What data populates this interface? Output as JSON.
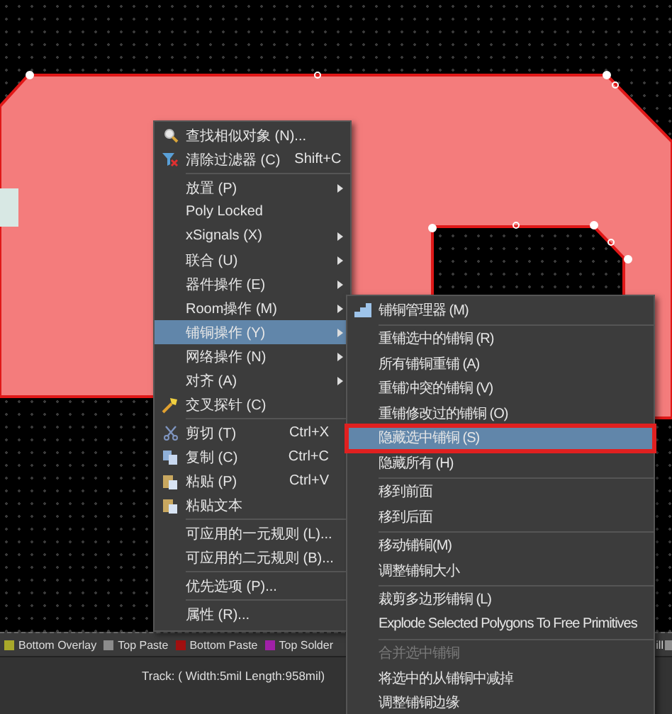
{
  "context_menu": {
    "items": [
      {
        "kind": "item",
        "label": "查找相似对象 (N)...",
        "selected": false,
        "has_submenu": false
      },
      {
        "kind": "item",
        "label": "清除过滤器 (C)",
        "shortcut": "Shift+C",
        "selected": false,
        "has_submenu": false
      },
      {
        "kind": "separator"
      },
      {
        "kind": "item",
        "label": "放置 (P)",
        "selected": false,
        "has_submenu": true
      },
      {
        "kind": "item",
        "label": "Poly Locked",
        "selected": false,
        "has_submenu": false
      },
      {
        "kind": "item",
        "label": "xSignals (X)",
        "selected": false,
        "has_submenu": true
      },
      {
        "kind": "item",
        "label": "联合 (U)",
        "selected": false,
        "has_submenu": true
      },
      {
        "kind": "item",
        "label": "器件操作 (E)",
        "selected": false,
        "has_submenu": true
      },
      {
        "kind": "item",
        "label": "Room操作 (M)",
        "selected": false,
        "has_submenu": true
      },
      {
        "kind": "item",
        "label": "铺铜操作 (Y)",
        "selected": true,
        "has_submenu": true
      },
      {
        "kind": "item",
        "label": "网络操作 (N)",
        "selected": false,
        "has_submenu": true
      },
      {
        "kind": "item",
        "label": "对齐 (A)",
        "selected": false,
        "has_submenu": true
      },
      {
        "kind": "item",
        "label": "交叉探针 (C)",
        "selected": false,
        "has_submenu": false
      },
      {
        "kind": "separator"
      },
      {
        "kind": "item",
        "label": "剪切 (T)",
        "shortcut": "Ctrl+X",
        "selected": false,
        "has_submenu": false
      },
      {
        "kind": "item",
        "label": "复制 (C)",
        "shortcut": "Ctrl+C",
        "selected": false,
        "has_submenu": false
      },
      {
        "kind": "item",
        "label": "粘贴 (P)",
        "shortcut": "Ctrl+V",
        "selected": false,
        "has_submenu": false
      },
      {
        "kind": "item",
        "label": "粘贴文本",
        "selected": false,
        "has_submenu": false
      },
      {
        "kind": "separator"
      },
      {
        "kind": "item",
        "label": "可应用的一元规则 (L)...",
        "selected": false,
        "has_submenu": false
      },
      {
        "kind": "item",
        "label": "可应用的二元规则 (B)...",
        "selected": false,
        "has_submenu": false
      },
      {
        "kind": "separator"
      },
      {
        "kind": "item",
        "label": "优先选项 (P)...",
        "selected": false,
        "has_submenu": false
      },
      {
        "kind": "separator"
      },
      {
        "kind": "item",
        "label": "属性 (R)...",
        "selected": false,
        "has_submenu": false
      }
    ]
  },
  "submenu": {
    "items": [
      {
        "kind": "item",
        "label": "铺铜管理器 (M)",
        "selected": false,
        "disabled": false,
        "outlined": false
      },
      {
        "kind": "separator"
      },
      {
        "kind": "item",
        "label": "重铺选中的铺铜 (R)",
        "selected": false,
        "disabled": false,
        "outlined": false
      },
      {
        "kind": "item",
        "label": "所有铺铜重铺 (A)",
        "selected": false,
        "disabled": false,
        "outlined": false
      },
      {
        "kind": "item",
        "label": "重铺冲突的铺铜 (V)",
        "selected": false,
        "disabled": false,
        "outlined": false
      },
      {
        "kind": "item",
        "label": "重铺修改过的铺铜 (O)",
        "selected": false,
        "disabled": false,
        "outlined": false
      },
      {
        "kind": "item",
        "label": "隐藏选中铺铜 (S)",
        "selected": true,
        "disabled": false,
        "outlined": true
      },
      {
        "kind": "item",
        "label": "隐藏所有 (H)",
        "selected": false,
        "disabled": false,
        "outlined": false
      },
      {
        "kind": "separator"
      },
      {
        "kind": "item",
        "label": "移到前面",
        "selected": false,
        "disabled": false,
        "outlined": false
      },
      {
        "kind": "item",
        "label": "移到后面",
        "selected": false,
        "disabled": false,
        "outlined": false
      },
      {
        "kind": "separator"
      },
      {
        "kind": "item",
        "label": "移动铺铜(M)",
        "selected": false,
        "disabled": false,
        "outlined": false
      },
      {
        "kind": "item",
        "label": "调整铺铜大小",
        "selected": false,
        "disabled": false,
        "outlined": false
      },
      {
        "kind": "separator"
      },
      {
        "kind": "item",
        "label": "裁剪多边形铺铜 (L)",
        "selected": false,
        "disabled": false,
        "outlined": false
      },
      {
        "kind": "item",
        "label": "Explode Selected Polygons To Free Primitives",
        "selected": false,
        "disabled": false,
        "outlined": false
      },
      {
        "kind": "separator"
      },
      {
        "kind": "item",
        "label": "合并选中铺铜",
        "selected": false,
        "disabled": true,
        "outlined": false
      },
      {
        "kind": "item",
        "label": "将选中的从铺铜中减掉",
        "selected": false,
        "disabled": false,
        "outlined": false
      },
      {
        "kind": "item",
        "label": "调整铺铜边缘",
        "selected": false,
        "disabled": false,
        "outlined": false
      }
    ]
  },
  "layers": [
    {
      "label": "Bottom Overlay",
      "color": "#a8a82a"
    },
    {
      "label": "Top Paste",
      "color": "#8c8c8c"
    },
    {
      "label": "Bottom Paste",
      "color": "#a01010"
    },
    {
      "label": "Top Solder",
      "color": "#a020a8"
    },
    {
      "label": "ill",
      "color": "#909090"
    }
  ],
  "status_bar": {
    "text": "Track: ( Width:5mil Length:958mil)"
  }
}
